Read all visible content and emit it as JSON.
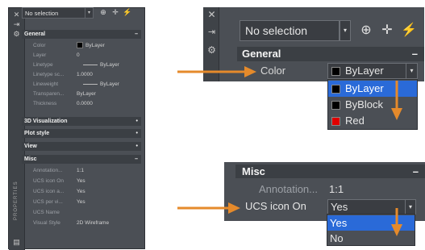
{
  "left_palette": {
    "selection": "No selection",
    "vertical_title": "PROPERTIES",
    "sections": {
      "general": "General",
      "viz3d": "3D Visualization",
      "plot": "Plot style",
      "view": "View",
      "misc": "Misc"
    },
    "general_rows": [
      {
        "label": "Color",
        "value": "ByLayer"
      },
      {
        "label": "Layer",
        "value": "0"
      },
      {
        "label": "Linetype",
        "value": "ByLayer"
      },
      {
        "label": "Linetype sc...",
        "value": "1.0000"
      },
      {
        "label": "Lineweight",
        "value": "ByLayer"
      },
      {
        "label": "Transparen...",
        "value": "ByLayer"
      },
      {
        "label": "Thickness",
        "value": "0.0000"
      }
    ],
    "misc_rows": [
      {
        "label": "Annotation...",
        "value": "1:1"
      },
      {
        "label": "UCS icon On",
        "value": "Yes"
      },
      {
        "label": "UCS icon a...",
        "value": "Yes"
      },
      {
        "label": "UCS per vi...",
        "value": "Yes"
      },
      {
        "label": "UCS Name",
        "value": ""
      },
      {
        "label": "Visual Style",
        "value": "2D Wireframe"
      }
    ]
  },
  "zoom_top": {
    "selection": "No selection",
    "section": "General",
    "color_label": "Color",
    "color_value": "ByLayer",
    "options": [
      {
        "label": "ByLayer",
        "swatch": "#000000"
      },
      {
        "label": "ByBlock",
        "swatch": "#000000"
      },
      {
        "label": "Red",
        "swatch": "#e00000"
      }
    ]
  },
  "zoom_bottom": {
    "section": "Misc",
    "annotation_label": "Annotation...",
    "annotation_value": "1:1",
    "ucs_label": "UCS icon On",
    "ucs_value": "Yes",
    "options": [
      "Yes",
      "No"
    ]
  },
  "colors": {
    "panel": "#4b4f55",
    "header": "#3b3f44",
    "highlight": "#2a6ad8",
    "callout": "#e58a2b"
  }
}
